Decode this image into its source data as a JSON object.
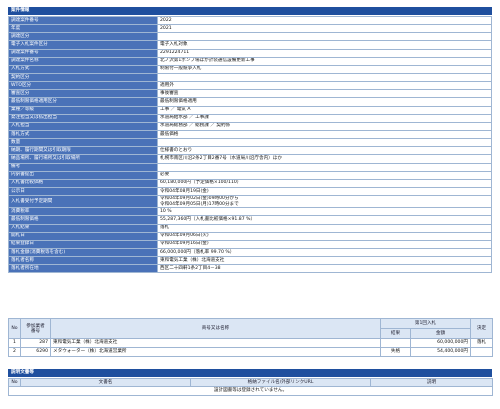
{
  "section_title": "案件情報",
  "detail_rows": [
    {
      "label": "調達案件番号",
      "value": "2022"
    },
    {
      "label": "年度",
      "value": "2021"
    },
    {
      "label": "調達区分",
      "value": ""
    },
    {
      "label": "電子入札案件区分",
      "value": "電子入札対象"
    },
    {
      "label": "調達案件番号",
      "value": "2291224711"
    },
    {
      "label": "調達案件名称",
      "value": "北ノ沢第1ポンプ場ほか計装通信設備更新工事"
    },
    {
      "label": "入札方式",
      "value": "制限付一般競争入札"
    },
    {
      "label": "契約区分",
      "value": ""
    },
    {
      "label": "WTO区分",
      "value": "適用外"
    },
    {
      "label": "審査区分",
      "value": "事後審査"
    },
    {
      "label": "最低制限価格適用区分",
      "value": "最低制限価格適用"
    },
    {
      "label": "業種／等級",
      "value": "工事 ／ 電気 A"
    },
    {
      "label": "発注担当又は払出担当",
      "value": "水道局給水部 ／ 工事課"
    },
    {
      "label": "入札担当",
      "value": "水道局総務部 ／ 総務課 ／ 契約係"
    },
    {
      "label": "落札方式",
      "value": "最低価格"
    },
    {
      "label": "数量",
      "value": ""
    },
    {
      "label": "納期、履行期間又は引取期限",
      "value": "仕様書のとおり"
    },
    {
      "label": "納品場所、履行場所又は引取場所",
      "value": "札幌市南区川沿2条2丁目2番7号（水道局川沿庁舎内）ほか"
    },
    {
      "label": "備考",
      "value": ""
    },
    {
      "label": "内訳書提出",
      "value": "必要"
    },
    {
      "label": "入札書比較価格",
      "value": "60,180,000円（予定価格×100/110）"
    },
    {
      "label": "公示日",
      "value": "令和04年08月19日(金)"
    },
    {
      "label": "入札書受付予定期間",
      "value": "令和04年09月02日(金)09時00分から\n令和04年09月05日(月)17時00分まで"
    },
    {
      "label": "消費税率",
      "value": "10 %"
    },
    {
      "label": "最低制限価格",
      "value": "55,287,360円（入札書比較価格×91.87 %）"
    },
    {
      "label": "入札結果",
      "value": "落札"
    },
    {
      "label": "開札日",
      "value": "令和04年09月06日(火)"
    },
    {
      "label": "結果登録日",
      "value": "令和04年09月16日(金)"
    },
    {
      "label": "落札金額(消費税等を含む)",
      "value": "66,000,000円（落札率 99.70 %）"
    },
    {
      "label": "落札者名称",
      "value": "東和電気工業（株）北海道支社"
    },
    {
      "label": "落札者所在地",
      "value": "西区二十四軒1条2丁目4－38"
    }
  ],
  "bids_table": {
    "headers": {
      "no": "No",
      "participant_no": "参加業者\n番号",
      "name": "商号又は名称",
      "round1": "第1回入札",
      "result": "結果",
      "amount": "金額",
      "decision": "決定"
    },
    "rows": [
      {
        "no": "1",
        "participant_no": "287",
        "name": "東和電気工業（株）北海道支社",
        "result": "",
        "amount": "60,000,000円",
        "decision": "落札"
      },
      {
        "no": "2",
        "participant_no": "6290",
        "name": "メタウォーター（株）北海道営業所",
        "result": "失格",
        "amount": "54,400,000円",
        "decision": ""
      }
    ]
  },
  "docs_section": {
    "title": "説明文書等",
    "headers": {
      "no": "No",
      "doc": "文書名",
      "file": "格納ファイル名/外部リンクURL",
      "desc": "説明"
    },
    "empty_message": "設計図書等は登録されていません。"
  },
  "colors": {
    "header_bg": "#1f4f9e",
    "label_bg": "#4a72b8",
    "table_header_bg": "#dbe6f4",
    "border": "#9fb6d3"
  }
}
